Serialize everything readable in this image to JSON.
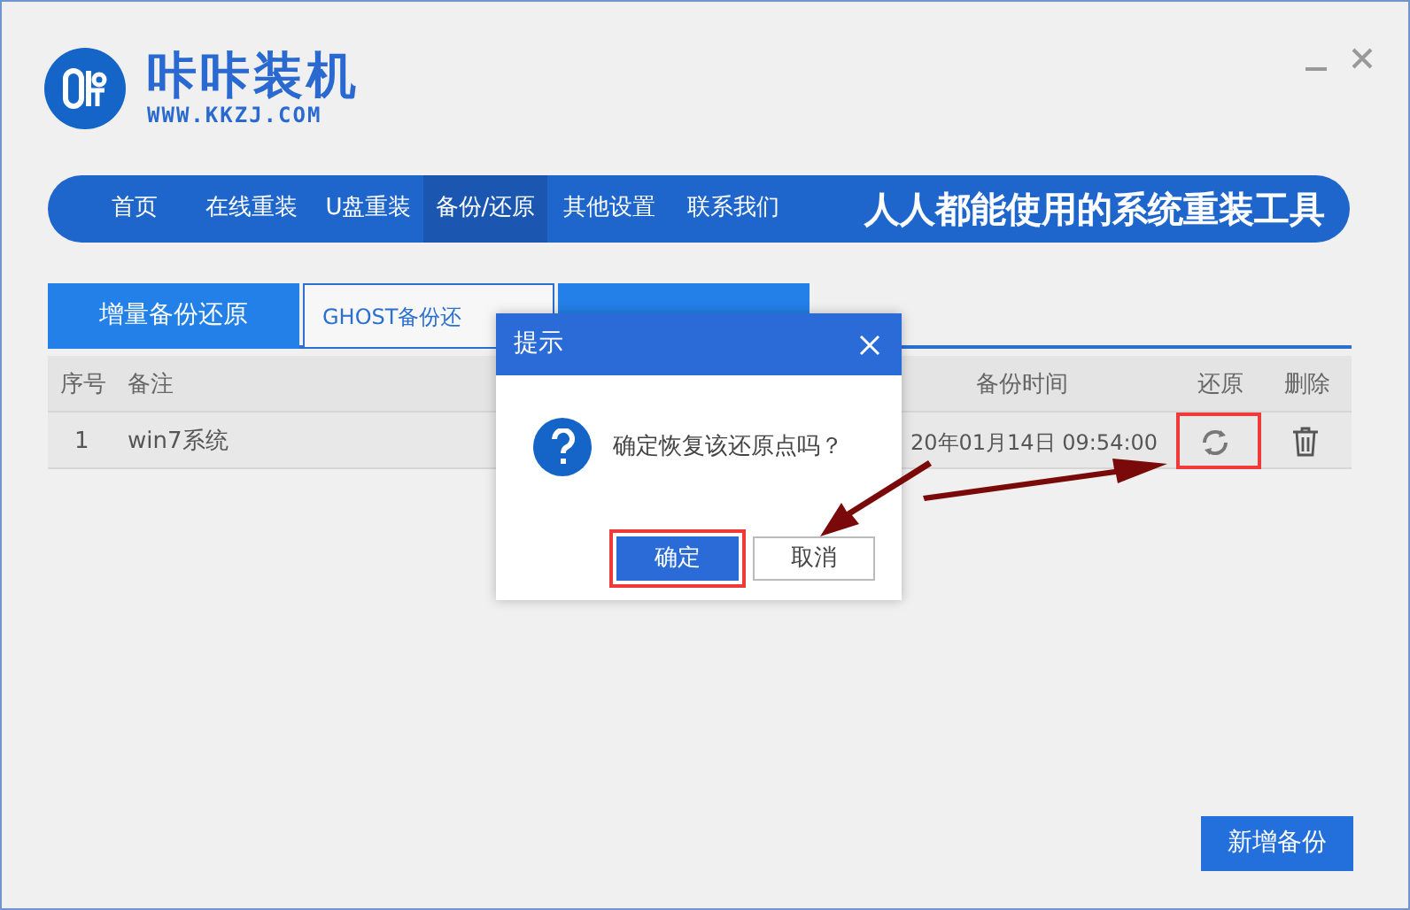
{
  "app": {
    "title": "咔咔装机",
    "url": "WWW.KKZJ.COM",
    "slogan": "人人都能使用的系统重装工具"
  },
  "nav": [
    {
      "label": "首页",
      "selected": false
    },
    {
      "label": "在线重装",
      "selected": false
    },
    {
      "label": "U盘重装",
      "selected": false
    },
    {
      "label": "备份/还原",
      "selected": true
    },
    {
      "label": "其他设置",
      "selected": false
    },
    {
      "label": "联系我们",
      "selected": false
    }
  ],
  "tabs": [
    {
      "label": "增量备份还原",
      "selected": false
    },
    {
      "label": "GHOST备份还",
      "selected": true
    },
    {
      "selected": false
    }
  ],
  "table": {
    "columns": [
      "序号",
      "备注",
      "备份时间",
      "还原",
      "删除"
    ],
    "rows": [
      {
        "index": "1",
        "note": "win7系统",
        "time": "20年01月14日 09:54:00"
      }
    ]
  },
  "dialog": {
    "title": "提示",
    "message": "确定恢复该还原点吗？",
    "buttons": [
      {
        "label": "确定",
        "kind": "primary"
      },
      {
        "label": "取消",
        "kind": "secondary"
      }
    ]
  },
  "add_button": "新增备份"
}
